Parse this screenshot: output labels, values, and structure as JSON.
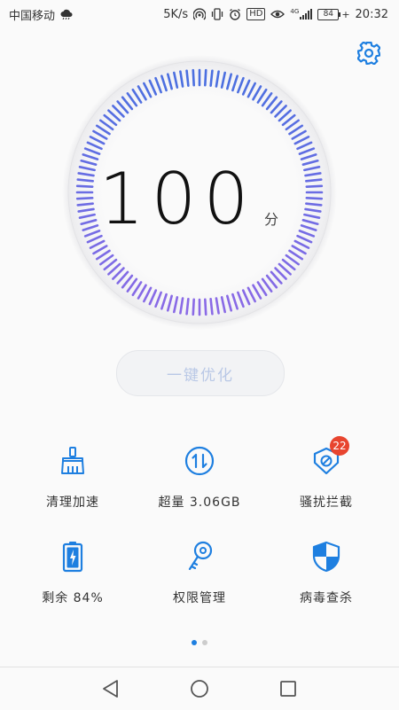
{
  "status_bar": {
    "carrier": "中国移动",
    "speed": "5K/s",
    "hd_label": "HD",
    "network": "4G",
    "battery_level": "84",
    "time": "20:32"
  },
  "gauge": {
    "score": "100",
    "unit": "分"
  },
  "optimize_button": {
    "label": "一键优化"
  },
  "features": [
    {
      "label": "清理加速",
      "icon": "broom-icon"
    },
    {
      "label": "超量 3.06GB",
      "icon": "data-transfer-icon"
    },
    {
      "label": "骚扰拦截",
      "icon": "shield-block-icon",
      "badge": "22"
    },
    {
      "label": "剩余 84%",
      "icon": "battery-icon"
    },
    {
      "label": "权限管理",
      "icon": "key-icon"
    },
    {
      "label": "病毒查杀",
      "icon": "security-shield-icon"
    }
  ],
  "pager": {
    "pages": 2,
    "active": 0
  },
  "colors": {
    "accent": "#1e7fe0",
    "gauge_start": "#4b6fe0",
    "gauge_end": "#8a6ae6",
    "badge": "#e8452f"
  }
}
